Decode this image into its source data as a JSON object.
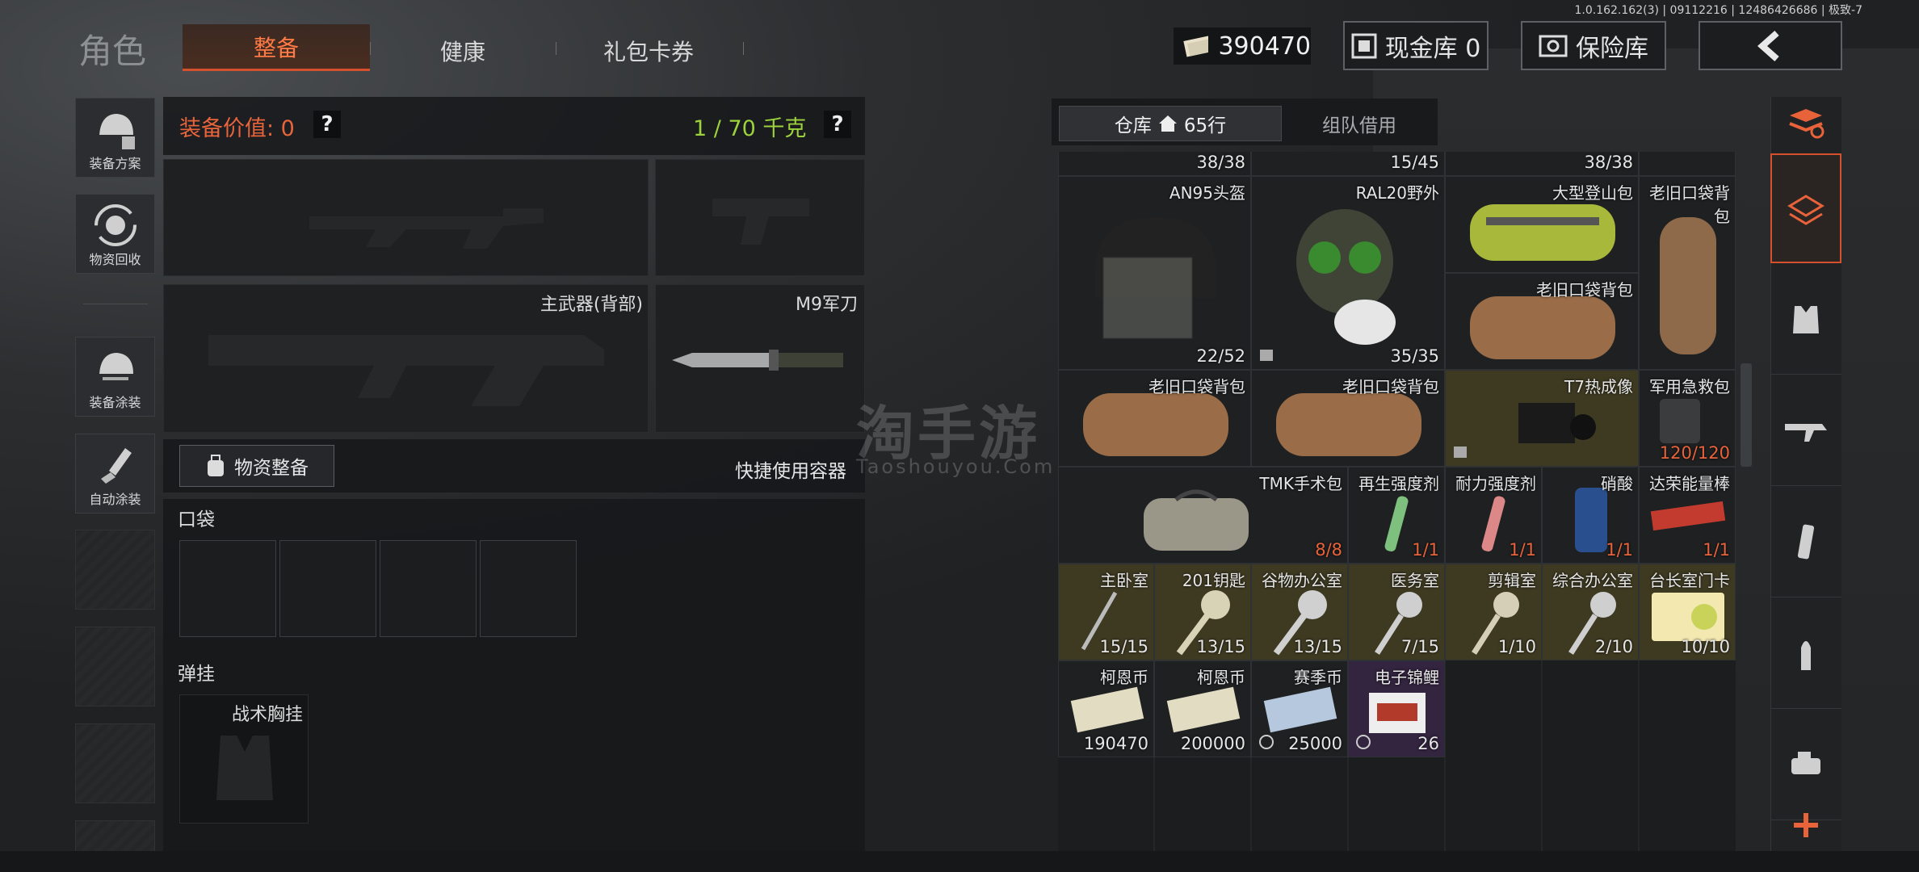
{
  "version": "1.0.162.162(3) | 09112216 | 12486426686 | 极致-7",
  "header": {
    "title": "角色",
    "tabs": [
      "整备",
      "健康",
      "礼包卡券"
    ],
    "money": "390470",
    "cash_label": "现金库 0",
    "insurance_label": "保险库",
    "active_color": "#d5502c"
  },
  "side": {
    "items": [
      "装备方案",
      "物资回收",
      "装备涂装",
      "自动涂装"
    ]
  },
  "equip": {
    "value_label": "装备价值: 0",
    "weight_label": "1 / 70 千克",
    "primary_back": "主武器(背部)",
    "melee": "M9军刀",
    "supply_btn": "物资整备",
    "quick_container": "快捷使用容器",
    "pocket": "口袋",
    "rig": "弹挂",
    "rig_item": "战术胸挂"
  },
  "warehouse": {
    "tab1": "仓库",
    "rows": "65行",
    "tab2": "组队借用",
    "watermark": "淘手游",
    "watermark_en": "Taoshouyou.Com",
    "top_counts": [
      "38/38",
      "15/45",
      "38/38"
    ],
    "items": [
      {
        "name": "AN95头盔",
        "count": "22/52"
      },
      {
        "name": "RAL20野外",
        "count": "35/35"
      },
      {
        "name": "大型登山包",
        "count": ""
      },
      {
        "name": "老旧口袋背包",
        "count": ""
      },
      {
        "name": "老旧口袋背包",
        "count": ""
      },
      {
        "name": "老旧口袋背包",
        "count": ""
      },
      {
        "name": "老旧口袋背包",
        "count": ""
      },
      {
        "name": "T7热成像",
        "count": ""
      },
      {
        "name": "军用急救包",
        "count": "120/120"
      },
      {
        "name": "TMK手术包",
        "count": "8/8"
      },
      {
        "name": "再生强度剂",
        "count": "1/1"
      },
      {
        "name": "耐力强度剂",
        "count": "1/1"
      },
      {
        "name": "硝酸",
        "count": "1/1"
      },
      {
        "name": "达荣能量棒",
        "count": "1/1"
      },
      {
        "name": "主卧室",
        "count": "15/15"
      },
      {
        "name": "201钥匙",
        "count": "13/15"
      },
      {
        "name": "谷物办公室",
        "count": "13/15"
      },
      {
        "name": "医务室",
        "count": "7/15"
      },
      {
        "name": "剪辑室",
        "count": "1/10"
      },
      {
        "name": "综合办公室",
        "count": "2/10"
      },
      {
        "name": "台长室门卡",
        "count": "10/10"
      },
      {
        "name": "柯恩币",
        "count": "190470"
      },
      {
        "name": "柯恩币",
        "count": "200000"
      },
      {
        "name": "赛季币",
        "count": "25000"
      },
      {
        "name": "电子锦鲤",
        "count": "26"
      }
    ]
  },
  "icons": [
    "back-arrow-icon",
    "money-icon",
    "cash-safe-icon",
    "insurance-safe-icon",
    "home-icon",
    "sort-icon",
    "backpack-icon",
    "armor-icon",
    "rifle-icon",
    "magazine-icon",
    "ammo-icon",
    "scope-icon",
    "plus-icon"
  ]
}
